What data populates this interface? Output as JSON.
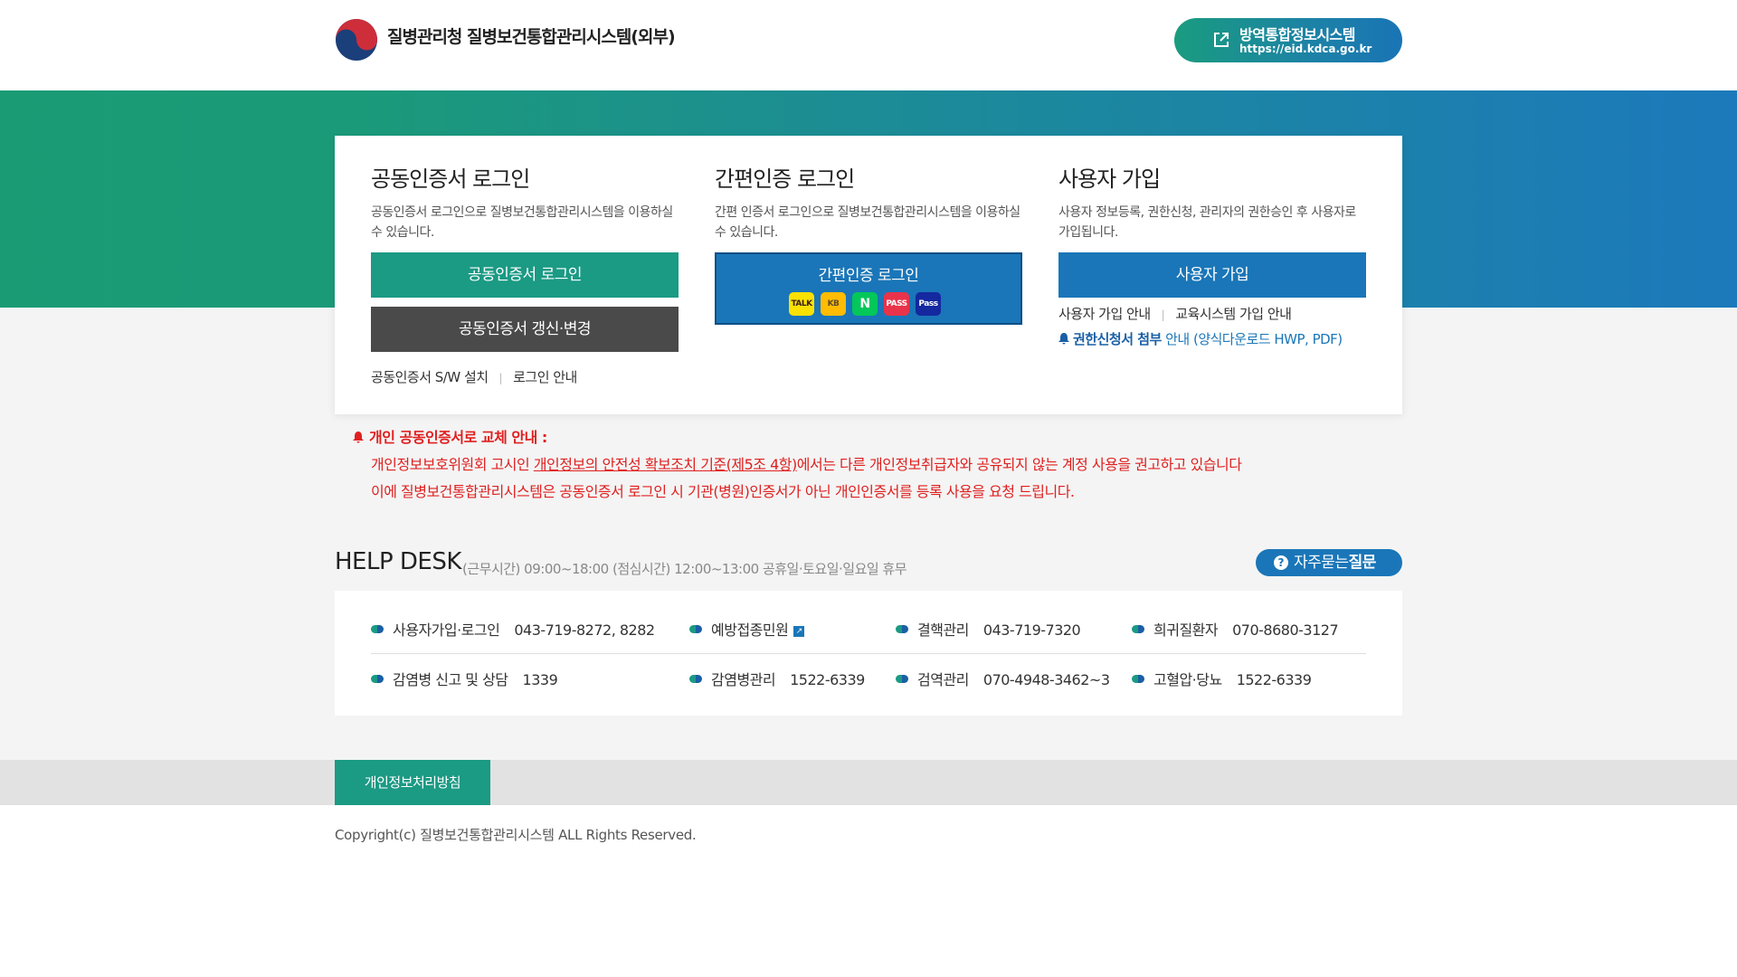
{
  "header": {
    "site_title": "질병관리청 질병보건통합관리시스템(외부)",
    "eid_title": "방역통합정보시스템",
    "eid_url": "https://eid.kdca.go.kr"
  },
  "login": {
    "cert": {
      "title": "공동인증서 로그인",
      "desc": "공동인증서 로그인으로 질병보건통합관리시스템을 이용하실 수 있습니다.",
      "login_btn": "공동인증서 로그인",
      "renew_btn": "공동인증서 갱신·변경",
      "link_install": "공동인증서 S/W 설치",
      "link_guide": "로그인 안내"
    },
    "simple": {
      "title": "간편인증 로그인",
      "desc": "간편 인증서 로그인으로 질병보건통합관리시스템을 이용하실 수 있습니다.",
      "btn": "간편인증 로그인",
      "providers": [
        "TALK",
        "KB",
        "N",
        "PASS",
        "Pass"
      ]
    },
    "signup": {
      "title": "사용자 가입",
      "desc": "사용자 정보등록, 권한신청, 관리자의 권한승인 후 사용자로 가입됩니다.",
      "btn": "사용자 가입",
      "link_guide": "사용자 가입 안내",
      "link_edu": "교육시스템 가입 안내",
      "perm_bold": "권한신청서 첨부",
      "perm_rest": " 안내 (양식다운로드 HWP, PDF)"
    }
  },
  "notice": {
    "head": "개인 공동인증서로 교체 안내 :",
    "line1_pre": "개인정보보호위원회 고시인 ",
    "line1_link": "개인정보의 안전성 확보조치 기준(제5조 4항)",
    "line1_post": "에서는 다른 개인정보취급자와 공유되지 않는 계정 사용을 권고하고 있습니다",
    "line2": "이에 질병보건통합관리시스템은 공동인증서 로그인 시 기관(병원)인증서가 아닌 개인인증서를 등록 사용을 요청 드립니다."
  },
  "helpdesk": {
    "title": "HELP DESK",
    "hours": "(근무시간) 09:00~18:00 (점심시간) 12:00~13:00 공휴일·토요일·일요일 휴무",
    "faq_pre": "자주묻는",
    "faq_bold": "질문",
    "items": [
      {
        "label": "사용자가입·로그인",
        "number": "043-719-8272, 8282"
      },
      {
        "label": "예방접종민원",
        "number": ""
      },
      {
        "label": "결핵관리",
        "number": "043-719-7320"
      },
      {
        "label": "희귀질환자",
        "number": "070-8680-3127"
      },
      {
        "label": "감염병 신고 및 상담",
        "number": "1339"
      },
      {
        "label": "감염병관리",
        "number": "1522-6339"
      },
      {
        "label": "검역관리",
        "number": "070-4948-3462~3"
      },
      {
        "label": "고혈압·당뇨",
        "number": "1522-6339"
      }
    ]
  },
  "footer": {
    "privacy": "개인정보처리방침",
    "copyright": "Copyright(c) 질병보건통합관리시스템 ALL Rights Reserved."
  }
}
